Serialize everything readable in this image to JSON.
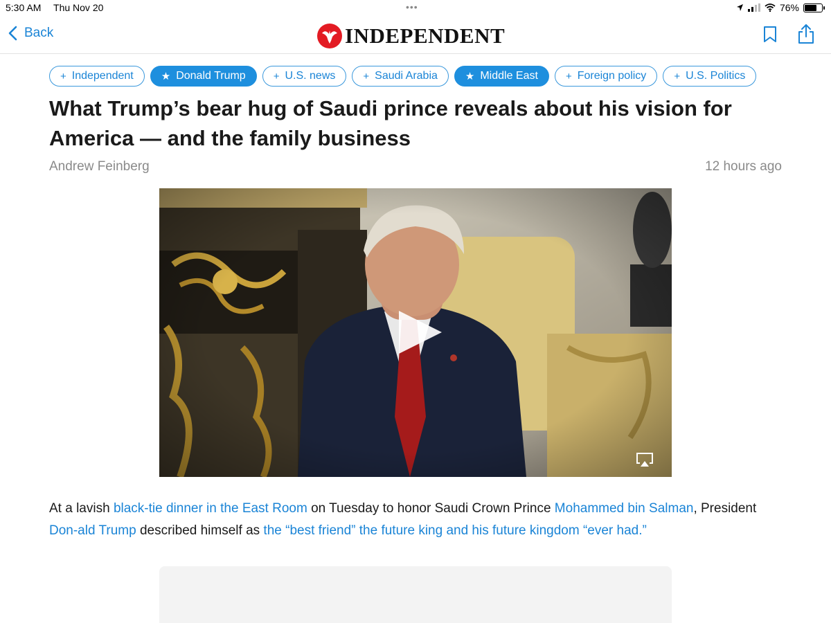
{
  "status": {
    "time": "5:30 AM",
    "date": "Thu Nov 20",
    "battery": "76%",
    "battery_level": 0.76
  },
  "nav": {
    "back_label": "Back",
    "logo_text": "INDEPENDENT",
    "icons": [
      "chevron-left-icon",
      "eagle-logo-icon",
      "bookmark-icon",
      "share-icon"
    ]
  },
  "tags": [
    {
      "label": "Independent",
      "icon": "plus",
      "active": false
    },
    {
      "label": "Donald Trump",
      "icon": "star",
      "active": true
    },
    {
      "label": "U.S. news",
      "icon": "plus",
      "active": false
    },
    {
      "label": "Saudi Arabia",
      "icon": "plus",
      "active": false
    },
    {
      "label": "Middle East",
      "icon": "star",
      "active": true
    },
    {
      "label": "Foreign policy",
      "icon": "plus",
      "active": false
    },
    {
      "label": "U.S. Politics",
      "icon": "plus",
      "active": false
    }
  ],
  "article": {
    "headline": "What Trump’s bear hug of Saudi prince reveals about his vision for America — and the family business",
    "author": "Andrew Feinberg",
    "timestamp": "12 hours ago",
    "paragraph": [
      {
        "text": "At a lavish ",
        "link": false
      },
      {
        "text": "black-tie dinner in the East Room",
        "link": true
      },
      {
        "text": " on Tuesday to honor Saudi Crown Prince ",
        "link": false
      },
      {
        "text": "Mohammed bin Salman",
        "link": true
      },
      {
        "text": ", President ",
        "link": false
      },
      {
        "text": "Don-­ald Trump",
        "link": true
      },
      {
        "text": " described himself as ",
        "link": false
      },
      {
        "text": "the “best friend” the future king and his future kingdom “ever had.”",
        "link": true
      }
    ]
  },
  "colors": {
    "accent": "#1a84d6",
    "logo_red": "#e31b23",
    "muted_text": "#8a8a8a"
  }
}
